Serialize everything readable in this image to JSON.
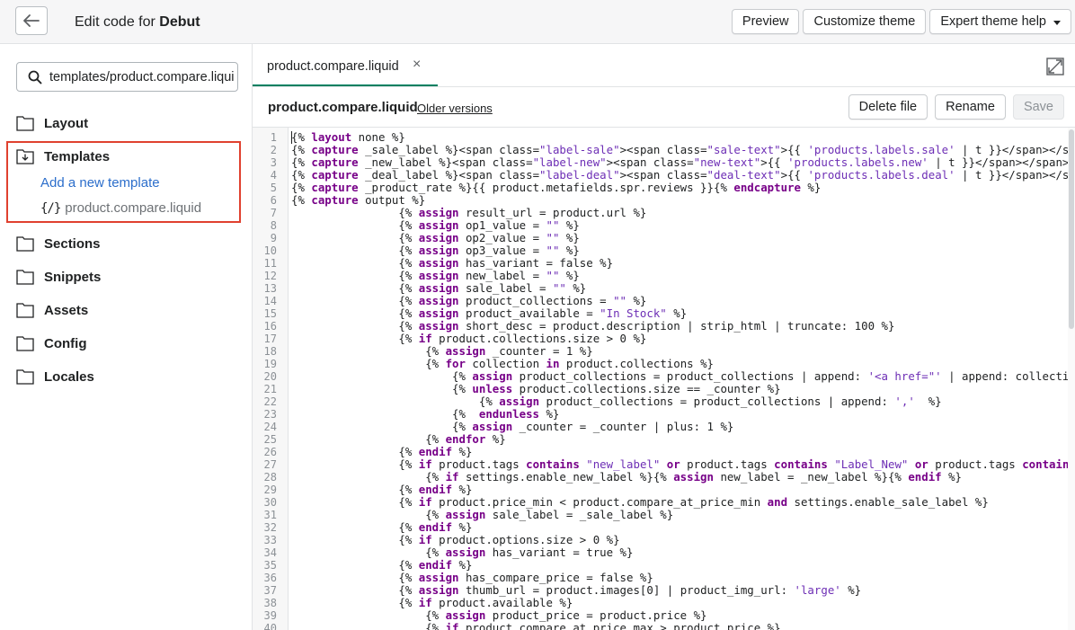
{
  "header": {
    "title_prefix": "Edit code for ",
    "theme_name": "Debut",
    "preview_label": "Preview",
    "customize_label": "Customize theme",
    "help_label": "Expert theme help"
  },
  "sidebar": {
    "search_value": "templates/product.compare.liquid",
    "folders": {
      "layout": "Layout",
      "templates": "Templates",
      "sections": "Sections",
      "snippets": "Snippets",
      "assets": "Assets",
      "config": "Config",
      "locales": "Locales"
    },
    "add_template": "Add a new template",
    "file_icon": "{/}",
    "file_name": "product.compare.liquid"
  },
  "editor": {
    "tab_name": "product.compare.liquid",
    "tab_close": "×",
    "file_name": "product.compare.liquid",
    "older_versions": "Older versions",
    "delete_label": "Delete file",
    "rename_label": "Rename",
    "save_label": "Save",
    "lines": [
      "{% layout none %}",
      "{% capture _sale_label %}<span class=\"label-sale\"><span class=\"sale-text\">{{ 'products.labels.sale' | t }}</span></span>{% endcapture %}",
      "{% capture _new_label %}<span class=\"label-new\"><span class=\"new-text\">{{ 'products.labels.new' | t }}</span></span>{% endcapture %}",
      "{% capture _deal_label %}<span class=\"label-deal\"><span class=\"deal-text\">{{ 'products.labels.deal' | t }}</span></span>{% endcapture %}",
      "{% capture _product_rate %}{{ product.metafields.spr.reviews }}{% endcapture %}",
      "{% capture output %}",
      "                {% assign result_url = product.url %}",
      "                {% assign op1_value = \"\" %}",
      "                {% assign op2_value = \"\" %}",
      "                {% assign op3_value = \"\" %}",
      "                {% assign has_variant = false %}",
      "                {% assign new_label = \"\" %}",
      "                {% assign sale_label = \"\" %}",
      "                {% assign product_collections = \"\" %}",
      "                {% assign product_available = \"In Stock\" %}",
      "                {% assign short_desc = product.description | strip_html | truncate: 100 %}",
      "                {% if product.collections.size > 0 %}",
      "                    {% assign _counter = 1 %}",
      "                    {% for collection in product.collections %}",
      "                        {% assign product_collections = product_collections | append: '<a href=\"' | append: collection.url | append: '\">' %}",
      "                        {% unless product.collections.size == _counter %}",
      "                            {% assign product_collections = product_collections | append: ','  %}",
      "                        {%  endunless %}",
      "                        {% assign _counter = _counter | plus: 1 %}",
      "                    {% endfor %}",
      "                {% endif %}",
      "                {% if product.tags contains \"new_label\" or product.tags contains \"Label_New\" or product.tags contains \"new\" %}",
      "                    {% if settings.enable_new_label %}{% assign new_label = _new_label %}{% endif %}",
      "                {% endif %}",
      "                {% if product.price_min < product.compare_at_price_min and settings.enable_sale_label %}",
      "                    {% assign sale_label = _sale_label %}",
      "                {% endif %}",
      "                {% if product.options.size > 0 %}",
      "                    {% assign has_variant = true %}",
      "                {% endif %}",
      "                {% assign has_compare_price = false %}",
      "                {% assign thumb_url = product.images[0] | product_img_url: 'large' %}",
      "                {% if product.available %}",
      "                    {% assign product_price = product.price %}",
      "                    {% if product.compare_at_price_max > product.price %}"
    ]
  }
}
